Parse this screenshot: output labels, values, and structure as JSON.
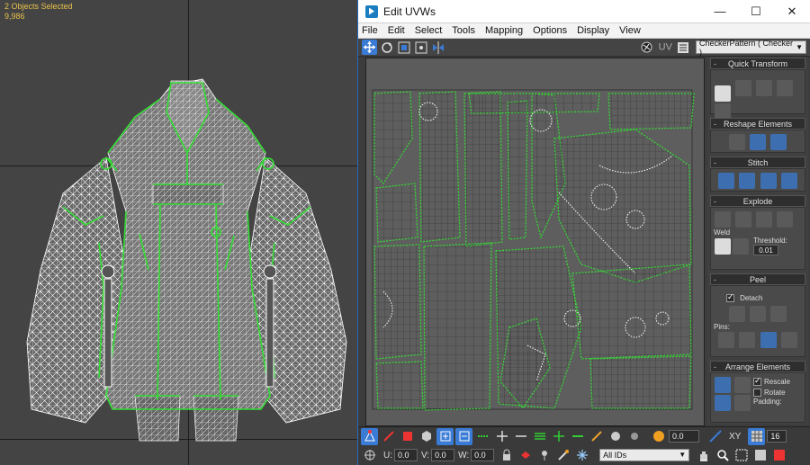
{
  "viewport": {
    "status_line1": "2 Objects Selected",
    "status_line2": "9,986"
  },
  "window": {
    "title": "Edit UVWs",
    "controls": {
      "minimize": "—",
      "maximize": "☐",
      "close": "✕"
    }
  },
  "menu": [
    "File",
    "Edit",
    "Select",
    "Tools",
    "Mapping",
    "Options",
    "Display",
    "View"
  ],
  "toolbar_top": {
    "uv_label": "UV",
    "checker_value": "CheckerPattern  ( Checker )"
  },
  "rollouts": {
    "quick_transform": "Quick Transform",
    "reshape_elements": "Reshape Elements",
    "stitch": "Stitch",
    "explode": "Explode",
    "weld": "Weld",
    "threshold_label": "Threshold:",
    "threshold_value": "0.01",
    "peel": "Peel",
    "detach_label": "Detach",
    "pins_label": "Pins:",
    "arrange_elements": "Arrange Elements",
    "rescale_label": "Rescale",
    "rotate_label": "Rotate",
    "padding_label": "Padding:"
  },
  "toolbar_bottom1": {
    "value_field": "0.0",
    "xy_label": "XY",
    "grid_value": "16"
  },
  "toolbar_bottom2": {
    "u_label": "U:",
    "u_value": "0.0",
    "v_label": "V:",
    "v_value": "0.0",
    "w_label": "W:",
    "w_value": "0.0",
    "ids_value": "All IDs"
  },
  "colors": {
    "accent": "#3a7bd5",
    "wire_white": "#ffffff",
    "seam_green": "#33dd33",
    "status_yellow": "#e8c24a"
  }
}
